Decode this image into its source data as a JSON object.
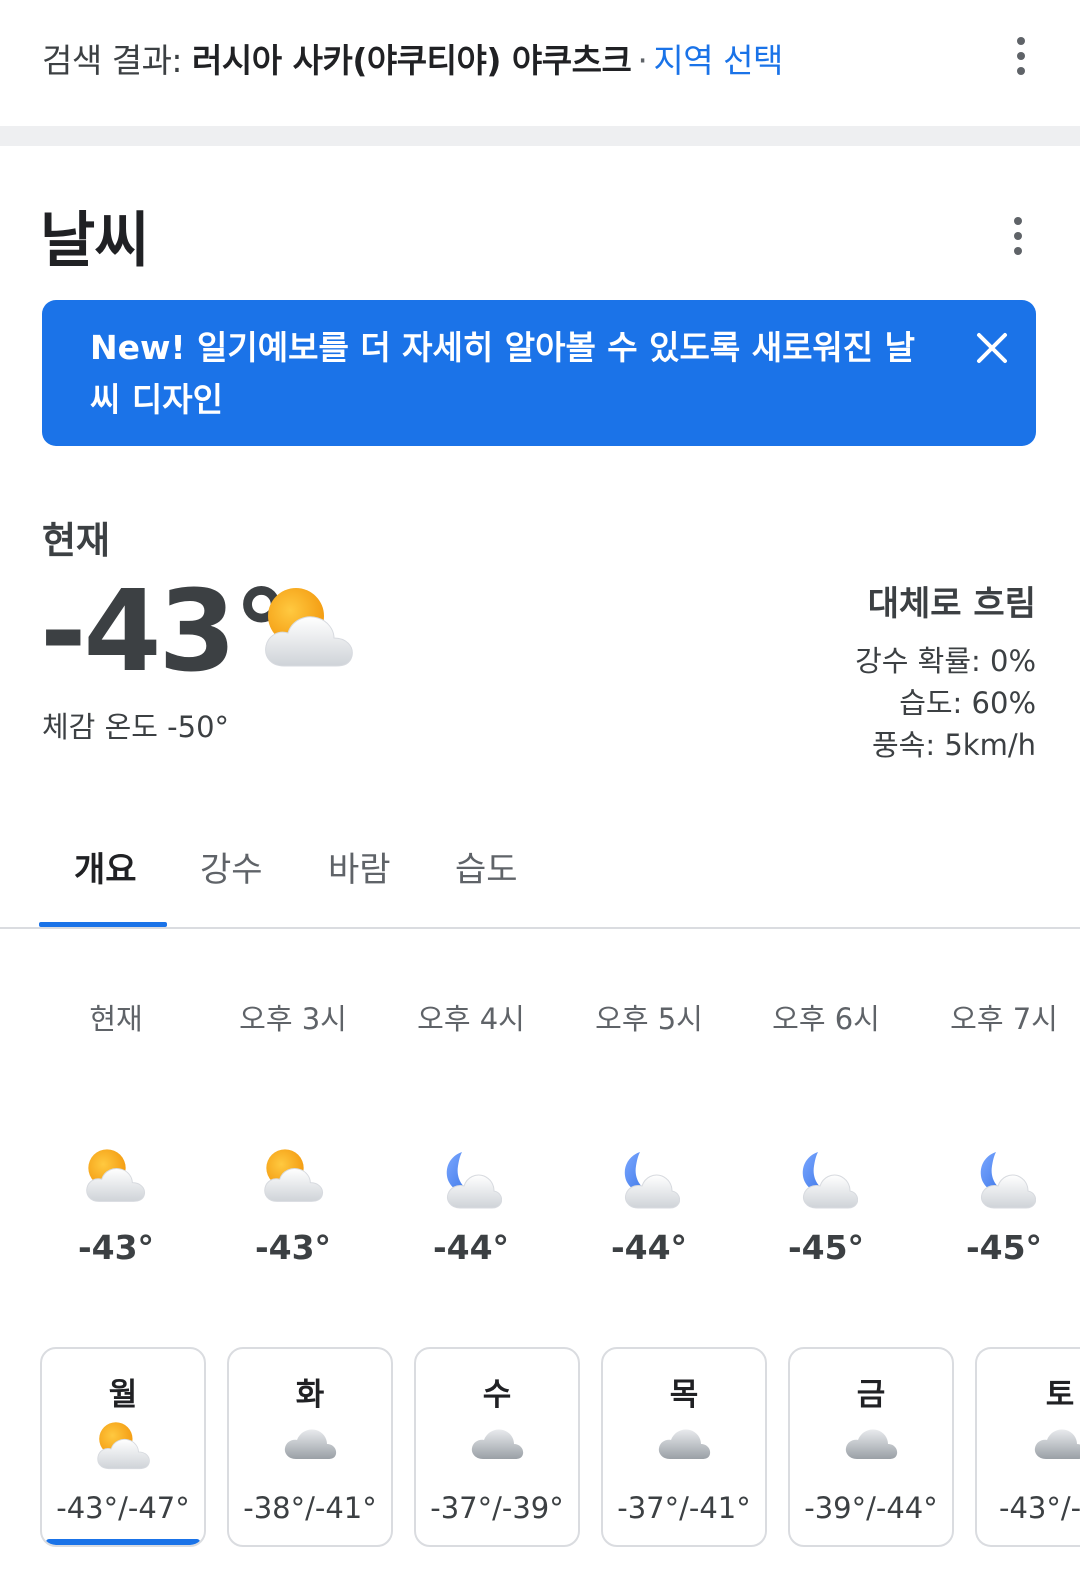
{
  "header": {
    "search_prefix": "검색 결과: ",
    "location": "러시아 사카(야쿠티야) 야쿠츠크",
    "separator": "·",
    "region_link": "지역 선택"
  },
  "card": {
    "title": "날씨"
  },
  "banner": {
    "text": "New! 일기예보를 더 자세히 알아볼 수 있도록 새로워진 날씨 디자인"
  },
  "current": {
    "label": "현재",
    "temperature": "-43°",
    "feels_like": "체감 온도 -50°",
    "condition": "대체로 흐림",
    "precipitation": "강수 확률: 0%",
    "humidity": "습도: 60%",
    "wind": "풍속: 5km/h",
    "icon": "partly-cloudy-day-icon"
  },
  "tabs": [
    {
      "label": "개요",
      "selected": true
    },
    {
      "label": "강수",
      "selected": false
    },
    {
      "label": "바람",
      "selected": false
    },
    {
      "label": "습도",
      "selected": false
    }
  ],
  "hourly": [
    {
      "time": "현재",
      "temp": "-43°",
      "icon": "partly-cloudy-day-icon"
    },
    {
      "time": "오후 3시",
      "temp": "-43°",
      "icon": "partly-cloudy-day-icon"
    },
    {
      "time": "오후 4시",
      "temp": "-44°",
      "icon": "partly-cloudy-night-icon"
    },
    {
      "time": "오후 5시",
      "temp": "-44°",
      "icon": "partly-cloudy-night-icon"
    },
    {
      "time": "오후 6시",
      "temp": "-45°",
      "icon": "partly-cloudy-night-icon"
    },
    {
      "time": "오후 7시",
      "temp": "-45°",
      "icon": "partly-cloudy-night-icon"
    }
  ],
  "daily": [
    {
      "day": "월",
      "temps": "-43°/-47°",
      "icon": "partly-cloudy-day-icon",
      "selected": true
    },
    {
      "day": "화",
      "temps": "-38°/-41°",
      "icon": "cloudy-icon",
      "selected": false
    },
    {
      "day": "수",
      "temps": "-37°/-39°",
      "icon": "cloudy-icon",
      "selected": false
    },
    {
      "day": "목",
      "temps": "-37°/-41°",
      "icon": "cloudy-icon",
      "selected": false
    },
    {
      "day": "금",
      "temps": "-39°/-44°",
      "icon": "cloudy-icon",
      "selected": false
    },
    {
      "day": "토",
      "temps": "-43°/-",
      "icon": "cloudy-icon",
      "selected": false
    }
  ],
  "colors": {
    "accent": "#1a73e8",
    "banner": "#1b73e8",
    "sun": "#f9a825",
    "moon": "#4f8df5"
  }
}
